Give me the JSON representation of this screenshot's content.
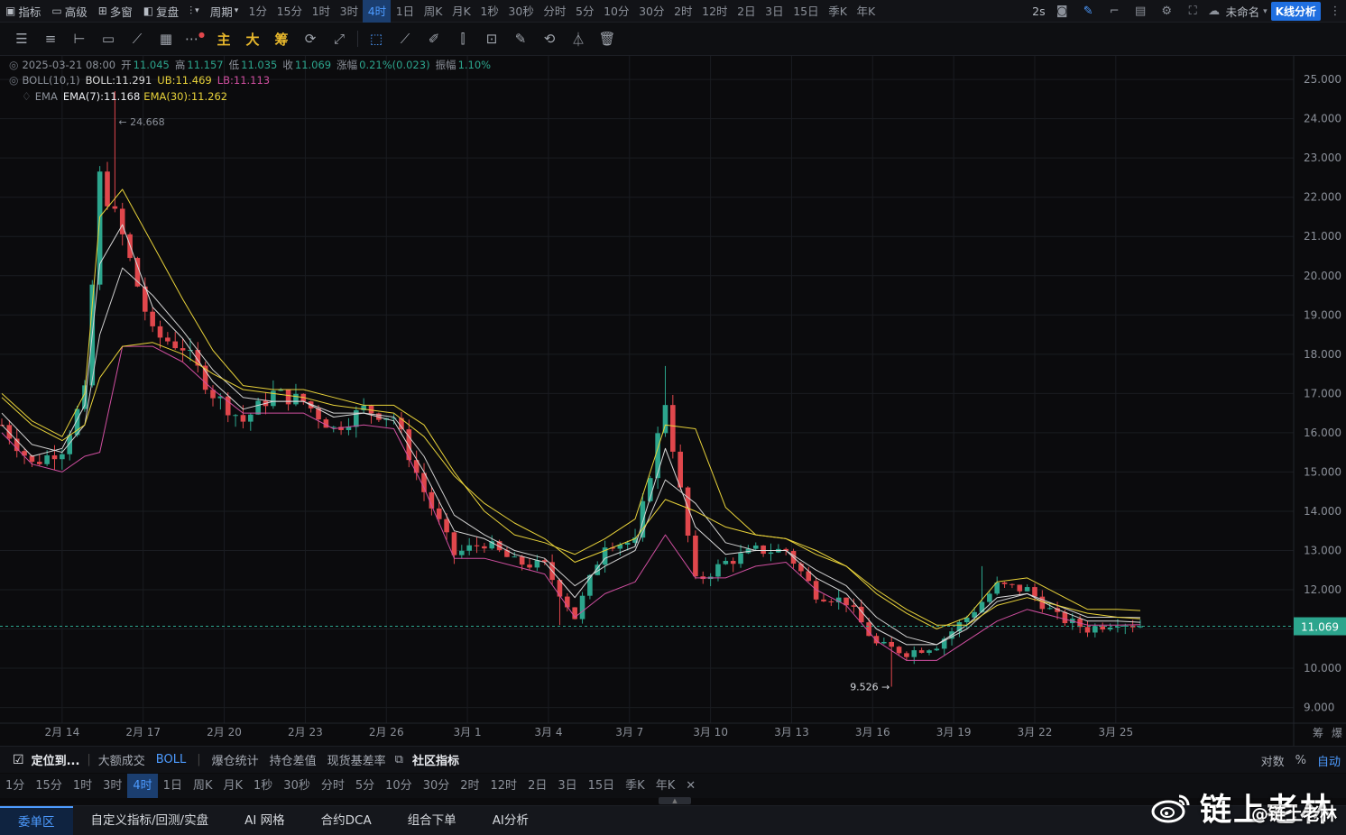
{
  "topbar": {
    "indicator": "指标",
    "advanced": "高级",
    "multi": "多窗",
    "replay": "复盘",
    "period": "周期",
    "periods": [
      "1分",
      "15分",
      "1时",
      "3时",
      "4时",
      "1日",
      "周K",
      "月K",
      "1秒",
      "30秒",
      "分时",
      "5分",
      "10分",
      "30分",
      "2时",
      "12时",
      "2日",
      "3日",
      "15日",
      "季K",
      "年K"
    ],
    "active_period": "4时",
    "refresh": "2s",
    "layout_name": "未命名",
    "analysis_button": "K线分析"
  },
  "drawbar": {
    "main": "主",
    "big": "大",
    "chips": "筹"
  },
  "legend": {
    "date": "2025-03-21 08:00",
    "open_label": "开",
    "open": "11.045",
    "high_label": "高",
    "high": "11.157",
    "low_label": "低",
    "low": "11.035",
    "close_label": "收",
    "close": "11.069",
    "change_label": "涨幅",
    "change": "0.21%(0.023)",
    "amp_label": "振幅",
    "amp": "1.10%",
    "boll_name": "BOLL(10,1)",
    "boll_mid": "BOLL:11.291",
    "boll_ub": "UB:11.469",
    "boll_lb": "LB:11.113",
    "ema_name": "EMA",
    "ema7": "EMA(7):11.168",
    "ema30": "EMA(30):11.262",
    "high_mark": "24.668"
  },
  "chart_data": {
    "type": "candlestick",
    "y_ticks": [
      "25.000",
      "24.000",
      "23.000",
      "22.000",
      "21.000",
      "20.000",
      "19.000",
      "18.000",
      "17.000",
      "16.000",
      "15.000",
      "14.000",
      "13.000",
      "12.000",
      "11.000",
      "10.000",
      "9.000"
    ],
    "x_ticks": [
      "2月 14",
      "2月 17",
      "2月 20",
      "2月 23",
      "2月 26",
      "3月 1",
      "3月 4",
      "3月 7",
      "3月 10",
      "3月 13",
      "3月 16",
      "3月 19",
      "3月 22",
      "3月 25"
    ],
    "ylim": [
      8.6,
      25.6
    ],
    "last_price": "11.069",
    "low_mark": "9.526",
    "price_path": [
      [
        0,
        16.2
      ],
      [
        4,
        15.2
      ],
      [
        8,
        15.6
      ],
      [
        11,
        17.0
      ],
      [
        13,
        22.5
      ],
      [
        16,
        21.0
      ],
      [
        20,
        18.5
      ],
      [
        24,
        18.2
      ],
      [
        28,
        17.0
      ],
      [
        32,
        16.3
      ],
      [
        36,
        17.0
      ],
      [
        40,
        16.8
      ],
      [
        44,
        16.1
      ],
      [
        48,
        16.6
      ],
      [
        52,
        16.4
      ],
      [
        56,
        14.5
      ],
      [
        60,
        12.9
      ],
      [
        64,
        13.2
      ],
      [
        68,
        12.7
      ],
      [
        72,
        12.6
      ],
      [
        76,
        11.3
      ],
      [
        80,
        13.2
      ],
      [
        84,
        13.2
      ],
      [
        88,
        16.8
      ],
      [
        92,
        12.2
      ],
      [
        96,
        12.7
      ],
      [
        100,
        13.0
      ],
      [
        104,
        13.0
      ],
      [
        108,
        11.9
      ],
      [
        112,
        11.7
      ],
      [
        116,
        10.6
      ],
      [
        120,
        10.4
      ],
      [
        124,
        10.6
      ],
      [
        128,
        11.3
      ],
      [
        132,
        12.1
      ],
      [
        136,
        12.0
      ],
      [
        140,
        11.3
      ],
      [
        144,
        11.0
      ],
      [
        148,
        11.2
      ],
      [
        151,
        11.07
      ]
    ],
    "ema_fast": [
      [
        0,
        16.2
      ],
      [
        4,
        15.4
      ],
      [
        8,
        15.6
      ],
      [
        11,
        16.7
      ],
      [
        13,
        20.3
      ],
      [
        16,
        21.3
      ],
      [
        20,
        19.2
      ],
      [
        24,
        18.4
      ],
      [
        28,
        17.3
      ],
      [
        32,
        16.6
      ],
      [
        36,
        16.8
      ],
      [
        40,
        16.8
      ],
      [
        44,
        16.4
      ],
      [
        48,
        16.5
      ],
      [
        52,
        16.3
      ],
      [
        56,
        15.0
      ],
      [
        60,
        13.5
      ],
      [
        64,
        13.3
      ],
      [
        68,
        12.9
      ],
      [
        72,
        12.7
      ],
      [
        76,
        11.8
      ],
      [
        80,
        12.8
      ],
      [
        84,
        13.1
      ],
      [
        88,
        15.6
      ],
      [
        92,
        13.6
      ],
      [
        96,
        12.9
      ],
      [
        100,
        13.0
      ],
      [
        104,
        13.0
      ],
      [
        108,
        12.3
      ],
      [
        112,
        11.9
      ],
      [
        116,
        11.0
      ],
      [
        120,
        10.6
      ],
      [
        124,
        10.6
      ],
      [
        128,
        11.1
      ],
      [
        132,
        11.8
      ],
      [
        136,
        11.9
      ],
      [
        140,
        11.5
      ],
      [
        144,
        11.2
      ],
      [
        148,
        11.2
      ],
      [
        151,
        11.17
      ]
    ],
    "ema_slow": [
      [
        0,
        16.9
      ],
      [
        4,
        16.2
      ],
      [
        8,
        15.8
      ],
      [
        11,
        16.2
      ],
      [
        13,
        17.4
      ],
      [
        16,
        18.2
      ],
      [
        20,
        18.3
      ],
      [
        24,
        18.0
      ],
      [
        28,
        17.5
      ],
      [
        32,
        17.1
      ],
      [
        36,
        17.0
      ],
      [
        40,
        16.9
      ],
      [
        44,
        16.7
      ],
      [
        48,
        16.6
      ],
      [
        52,
        16.5
      ],
      [
        56,
        15.9
      ],
      [
        60,
        14.9
      ],
      [
        64,
        14.2
      ],
      [
        68,
        13.7
      ],
      [
        72,
        13.3
      ],
      [
        76,
        12.7
      ],
      [
        80,
        13.0
      ],
      [
        84,
        13.3
      ],
      [
        88,
        14.3
      ],
      [
        92,
        14.0
      ],
      [
        96,
        13.6
      ],
      [
        100,
        13.4
      ],
      [
        104,
        13.3
      ],
      [
        108,
        12.9
      ],
      [
        112,
        12.6
      ],
      [
        116,
        12.0
      ],
      [
        120,
        11.5
      ],
      [
        124,
        11.1
      ],
      [
        128,
        11.1
      ],
      [
        132,
        11.6
      ],
      [
        136,
        11.8
      ],
      [
        140,
        11.6
      ],
      [
        144,
        11.4
      ],
      [
        148,
        11.3
      ],
      [
        151,
        11.26
      ]
    ],
    "boll_mid": [
      [
        0,
        16.5
      ],
      [
        4,
        15.7
      ],
      [
        8,
        15.5
      ],
      [
        11,
        16.2
      ],
      [
        13,
        18.5
      ],
      [
        16,
        20.2
      ],
      [
        20,
        19.5
      ],
      [
        24,
        18.6
      ],
      [
        28,
        17.6
      ],
      [
        32,
        16.9
      ],
      [
        36,
        16.8
      ],
      [
        40,
        16.8
      ],
      [
        44,
        16.5
      ],
      [
        48,
        16.5
      ],
      [
        52,
        16.4
      ],
      [
        56,
        15.4
      ],
      [
        60,
        13.9
      ],
      [
        64,
        13.4
      ],
      [
        68,
        13.0
      ],
      [
        72,
        12.8
      ],
      [
        76,
        12.1
      ],
      [
        80,
        12.6
      ],
      [
        84,
        13.0
      ],
      [
        88,
        14.8
      ],
      [
        92,
        14.2
      ],
      [
        96,
        13.2
      ],
      [
        100,
        13.0
      ],
      [
        104,
        13.0
      ],
      [
        108,
        12.5
      ],
      [
        112,
        12.1
      ],
      [
        116,
        11.3
      ],
      [
        120,
        10.8
      ],
      [
        124,
        10.6
      ],
      [
        128,
        11.0
      ],
      [
        132,
        11.7
      ],
      [
        136,
        11.9
      ],
      [
        140,
        11.6
      ],
      [
        144,
        11.3
      ],
      [
        148,
        11.3
      ],
      [
        151,
        11.29
      ]
    ],
    "boll_ub": [
      [
        0,
        17.0
      ],
      [
        4,
        16.3
      ],
      [
        8,
        15.9
      ],
      [
        11,
        17.0
      ],
      [
        13,
        21.5
      ],
      [
        16,
        22.2
      ],
      [
        20,
        20.8
      ],
      [
        24,
        19.4
      ],
      [
        28,
        18.1
      ],
      [
        32,
        17.2
      ],
      [
        36,
        17.1
      ],
      [
        40,
        17.1
      ],
      [
        44,
        16.9
      ],
      [
        48,
        16.7
      ],
      [
        52,
        16.7
      ],
      [
        56,
        16.2
      ],
      [
        60,
        15.0
      ],
      [
        64,
        14.0
      ],
      [
        68,
        13.4
      ],
      [
        72,
        13.2
      ],
      [
        76,
        12.9
      ],
      [
        80,
        13.3
      ],
      [
        84,
        13.8
      ],
      [
        88,
        16.2
      ],
      [
        92,
        16.1
      ],
      [
        96,
        14.1
      ],
      [
        100,
        13.4
      ],
      [
        104,
        13.3
      ],
      [
        108,
        13.0
      ],
      [
        112,
        12.6
      ],
      [
        116,
        11.9
      ],
      [
        120,
        11.4
      ],
      [
        124,
        11.0
      ],
      [
        128,
        11.3
      ],
      [
        132,
        12.2
      ],
      [
        136,
        12.3
      ],
      [
        140,
        11.9
      ],
      [
        144,
        11.5
      ],
      [
        148,
        11.5
      ],
      [
        151,
        11.47
      ]
    ],
    "boll_lb": [
      [
        0,
        16.0
      ],
      [
        4,
        15.2
      ],
      [
        8,
        15.0
      ],
      [
        11,
        15.4
      ],
      [
        13,
        15.5
      ],
      [
        16,
        18.2
      ],
      [
        20,
        18.2
      ],
      [
        24,
        17.8
      ],
      [
        28,
        17.1
      ],
      [
        32,
        16.5
      ],
      [
        36,
        16.5
      ],
      [
        40,
        16.5
      ],
      [
        44,
        16.1
      ],
      [
        48,
        16.2
      ],
      [
        52,
        16.1
      ],
      [
        56,
        14.6
      ],
      [
        60,
        12.8
      ],
      [
        64,
        12.8
      ],
      [
        68,
        12.6
      ],
      [
        72,
        12.4
      ],
      [
        76,
        11.3
      ],
      [
        80,
        11.9
      ],
      [
        84,
        12.2
      ],
      [
        88,
        13.4
      ],
      [
        92,
        12.3
      ],
      [
        96,
        12.3
      ],
      [
        100,
        12.6
      ],
      [
        104,
        12.7
      ],
      [
        108,
        12.0
      ],
      [
        112,
        11.6
      ],
      [
        116,
        10.7
      ],
      [
        120,
        10.2
      ],
      [
        124,
        10.2
      ],
      [
        128,
        10.7
      ],
      [
        132,
        11.2
      ],
      [
        136,
        11.5
      ],
      [
        140,
        11.3
      ],
      [
        144,
        11.1
      ],
      [
        148,
        11.1
      ],
      [
        151,
        11.11
      ]
    ],
    "colors": {
      "up": "#2ca58d",
      "down": "#e0474c",
      "ema_fast": "#d9d9d9",
      "ema_slow": "#e8d23a",
      "boll_mid": "#cfcfcf",
      "boll_ub": "#e8d23a",
      "boll_lb": "#d04fa0",
      "price_line": "#2ca58d"
    },
    "grid": true
  },
  "axis_bottom_right": {
    "chips": "筹",
    "burst": "爆"
  },
  "bar1": {
    "locate": "定位到...",
    "big_trade": "大额成交",
    "boll": "BOLL",
    "liquidation": "爆仓统计",
    "oi_diff": "持仓差值",
    "basis": "现货基差率",
    "community": "社区指标",
    "log": "对数",
    "pct": "%",
    "auto": "自动"
  },
  "bar2": {
    "periods": [
      "1分",
      "15分",
      "1时",
      "3时",
      "4时",
      "1日",
      "周K",
      "月K",
      "1秒",
      "30秒",
      "分时",
      "5分",
      "10分",
      "30分",
      "2时",
      "12时",
      "2日",
      "3日",
      "15日",
      "季K",
      "年K"
    ],
    "active": "4时"
  },
  "bar3": {
    "tabs": [
      "委单区",
      "自定义指标/回测/实盘",
      "AI 网格",
      "合约DCA",
      "组合下单",
      "AI分析"
    ],
    "active": "委单区"
  },
  "watermark": {
    "text": "链上老林",
    "sub": "@链上老林"
  }
}
